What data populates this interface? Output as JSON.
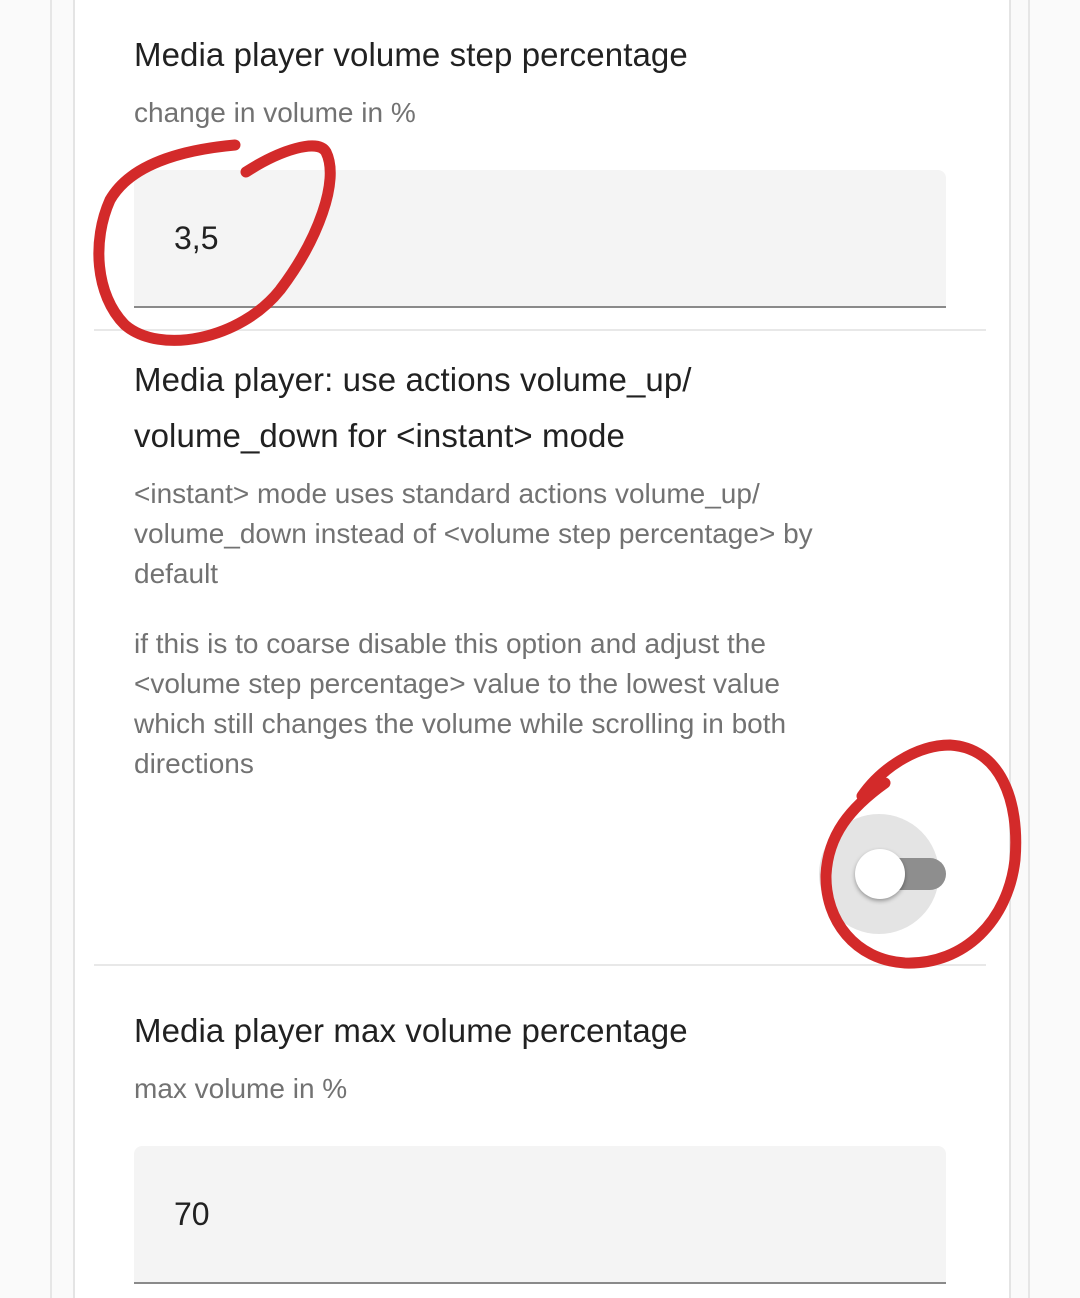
{
  "volume_step": {
    "title": "Media player volume step percentage",
    "description": "change in volume in %",
    "value": "3,5"
  },
  "instant_mode": {
    "title_line1": "Media player: use actions volume_up/",
    "title_line2": "volume_down for <instant> mode",
    "description1_line1": "<instant> mode uses standard actions volume_up/",
    "description1_line2": "volume_down instead of <volume step percentage> by",
    "description1_line3": "default",
    "description2_line1": "if this is to coarse disable this option and adjust the",
    "description2_line2": "<volume step percentage> value to the lowest value",
    "description2_line3": "which still changes the volume while scrolling in both",
    "description2_line4": "directions",
    "toggle_state": "off"
  },
  "max_volume": {
    "title": "Media player max volume percentage",
    "description": "max volume in %",
    "value": "70"
  },
  "colors": {
    "annotation": "#d32a2a",
    "field_background": "#f4f4f4",
    "toggle_track": "#8e8e8e"
  }
}
